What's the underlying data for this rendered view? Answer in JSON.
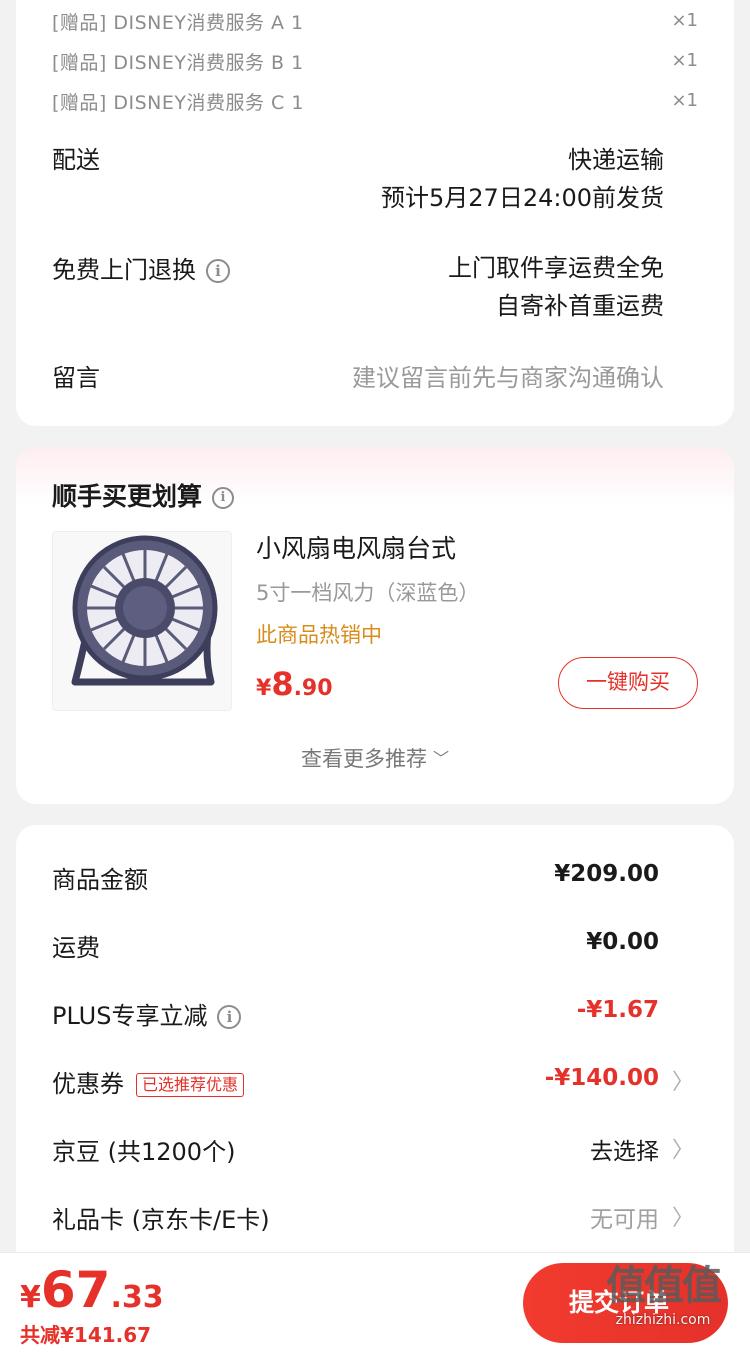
{
  "gifts": [
    {
      "label": "[赠品] DISNEY消费服务 A 1",
      "qty": "×1"
    },
    {
      "label": "[赠品] DISNEY消费服务 B 1",
      "qty": "×1"
    },
    {
      "label": "[赠品] DISNEY消费服务 C 1",
      "qty": "×1"
    }
  ],
  "delivery": {
    "label": "配送",
    "method": "快递运输",
    "eta": "预计5月27日24:00前发货"
  },
  "returns": {
    "label": "免费上门退换",
    "line1": "上门取件享运费全免",
    "line2": "自寄补首重运费"
  },
  "message": {
    "label": "留言",
    "placeholder": "建议留言前先与商家沟通确认"
  },
  "recommend": {
    "title": "顺手买更划算",
    "product_name": "小风扇电风扇台式",
    "product_spec": "5寸一档风力（深蓝色）",
    "product_hot": "此商品热销中",
    "price_symbol": "¥",
    "price_int": "8",
    "price_dec": ".90",
    "buy_label": "一键购买",
    "more_label": "查看更多推荐",
    "image_icon": "desk-fan-icon"
  },
  "fees": [
    {
      "label": "商品金额",
      "value": "¥209.00",
      "style": "bold"
    },
    {
      "label": "运费",
      "value": "¥0.00",
      "style": "bold"
    },
    {
      "label": "PLUS专享立减",
      "value": "-¥1.67",
      "style": "red"
    },
    {
      "label": "优惠券",
      "tag": "已选推荐优惠",
      "value": "-¥140.00",
      "style": "red"
    },
    {
      "label": "京豆 (共1200个)",
      "value": "去选择",
      "style": "normal"
    },
    {
      "label": "礼品卡 (京东卡/E卡)",
      "value": "无可用",
      "style": "grey"
    }
  ],
  "bottom": {
    "price_symbol": "¥",
    "price_int": "67",
    "price_dec": ".33",
    "saving": "共减¥141.67",
    "submit_label": "提交订单"
  },
  "watermark": {
    "logo": "值值值",
    "url": "zhizhizhi.com"
  },
  "colors": {
    "accent": "#e5312a",
    "hot": "#d98c1a",
    "background": "#f2f2f2"
  }
}
